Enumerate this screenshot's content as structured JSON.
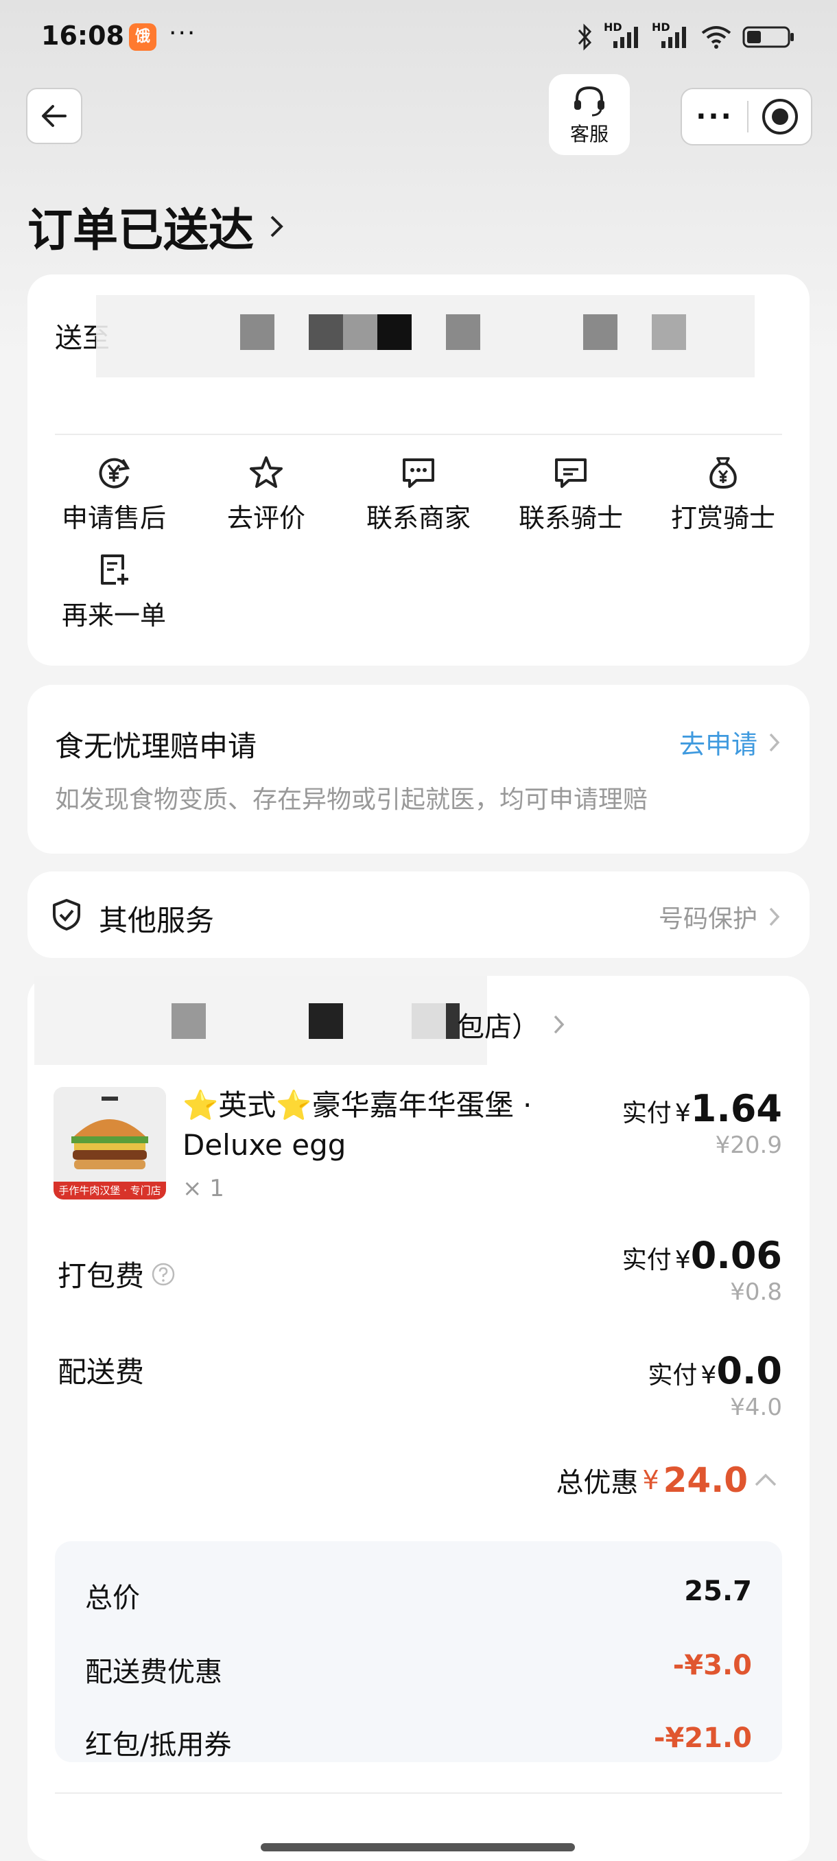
{
  "status_bar": {
    "time": "16:08",
    "app_badge": "饿",
    "more": "···",
    "net_label_1": "HD",
    "net_label_2": "HD"
  },
  "header": {
    "customer_service_label": "客服",
    "more_label": "···"
  },
  "title": "订单已送达",
  "address": {
    "label": "送至",
    "actions": [
      {
        "label": "申请售后",
        "icon": "yen-refresh-icon"
      },
      {
        "label": "去评价",
        "icon": "star-icon"
      },
      {
        "label": "联系商家",
        "icon": "chat-icon"
      },
      {
        "label": "联系骑士",
        "icon": "chat-icon"
      },
      {
        "label": "打赏骑士",
        "icon": "money-bag-icon"
      },
      {
        "label": "再来一单",
        "icon": "reorder-icon"
      }
    ]
  },
  "claim": {
    "title": "食无忧理赔申请",
    "link": "去申请",
    "desc": "如发现食物变质、存在异物或引起就医，均可申请理赔"
  },
  "services": {
    "title": "其他服务",
    "right": "号码保护"
  },
  "order": {
    "store_suffix": "包店）",
    "item": {
      "name_line1": "⭐英式⭐豪华嘉年华蛋堡 ·",
      "name_line2": "Deluxe egg",
      "qty": "× 1",
      "pay_label": "实付",
      "yen": "¥",
      "paid": "1.64",
      "original": "¥20.9",
      "img_banner": "手作牛肉汉堡 · 专门店"
    },
    "packing": {
      "label": "打包费",
      "pay_label": "实付",
      "yen": "¥",
      "paid": "0.06",
      "original": "¥0.8"
    },
    "delivery": {
      "label": "配送费",
      "pay_label": "实付",
      "yen": "¥",
      "paid": "0.0",
      "original": "¥4.0"
    },
    "total_discount": {
      "label": "总优惠",
      "yen": "¥",
      "value": "24.0"
    },
    "summary": [
      {
        "label": "总价",
        "value": "25.7"
      },
      {
        "label": "配送费优惠",
        "value": "-¥3.0"
      },
      {
        "label": "红包/抵用券",
        "value": "-¥21.0"
      }
    ]
  },
  "colors": {
    "accent_blue": "#3f9adf",
    "discount_red": "#e0562f"
  }
}
